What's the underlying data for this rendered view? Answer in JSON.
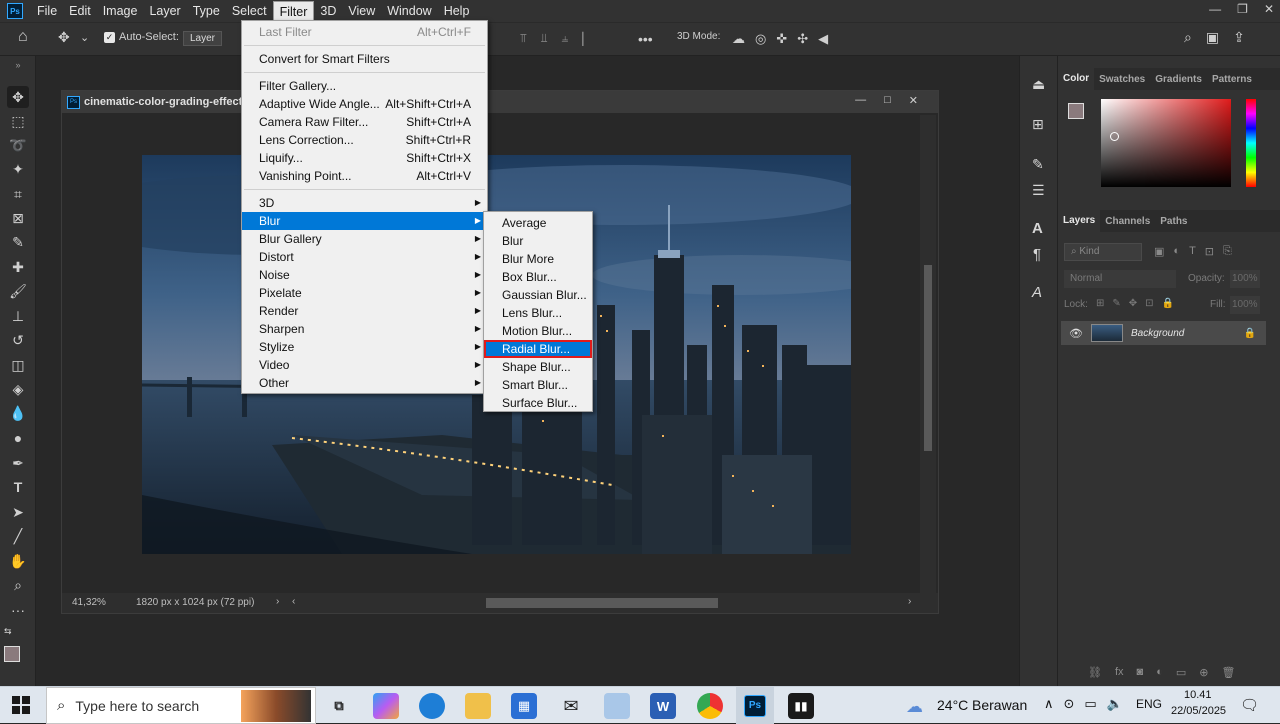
{
  "menubar": {
    "items": [
      "File",
      "Edit",
      "Image",
      "Layer",
      "Type",
      "Select",
      "Filter",
      "3D",
      "View",
      "Window",
      "Help"
    ],
    "active": "Filter"
  },
  "options": {
    "auto_select": "Auto-Select:",
    "layer_select": "Layer",
    "mode_3d": "3D Mode:"
  },
  "document": {
    "title": "cinematic-color-grading-effects-",
    "zoom": "41,32%",
    "dimensions": "1820 px x 1024 px (72 ppi)"
  },
  "filter_menu": {
    "group1": [
      {
        "label": "Last Filter",
        "shortcut": "Alt+Ctrl+F",
        "disabled": true
      }
    ],
    "group2": [
      {
        "label": "Convert for Smart Filters",
        "shortcut": ""
      }
    ],
    "group3": [
      {
        "label": "Filter Gallery...",
        "shortcut": ""
      },
      {
        "label": "Adaptive Wide Angle...",
        "shortcut": "Alt+Shift+Ctrl+A"
      },
      {
        "label": "Camera Raw Filter...",
        "shortcut": "Shift+Ctrl+A"
      },
      {
        "label": "Lens Correction...",
        "shortcut": "Shift+Ctrl+R"
      },
      {
        "label": "Liquify...",
        "shortcut": "Shift+Ctrl+X"
      },
      {
        "label": "Vanishing Point...",
        "shortcut": "Alt+Ctrl+V"
      }
    ],
    "group4": [
      "3D",
      "Blur",
      "Blur Gallery",
      "Distort",
      "Noise",
      "Pixelate",
      "Render",
      "Sharpen",
      "Stylize",
      "Video",
      "Other"
    ],
    "highlighted": "Blur"
  },
  "blur_submenu": {
    "items": [
      "Average",
      "Blur",
      "Blur More",
      "Box Blur...",
      "Gaussian Blur...",
      "Lens Blur...",
      "Motion Blur...",
      "Radial Blur...",
      "Shape Blur...",
      "Smart Blur...",
      "Surface Blur..."
    ],
    "highlighted": "Radial Blur..."
  },
  "color_panel": {
    "tabs": [
      "Color",
      "Swatches",
      "Gradients",
      "Patterns"
    ],
    "active": "Color",
    "hue_color": "#e01b1b"
  },
  "layers_panel": {
    "tabs": [
      "Layers",
      "Channels",
      "Paths"
    ],
    "active": "Layers",
    "kind_label": "Kind",
    "blend_mode": "Normal",
    "opacity_label": "Opacity:",
    "opacity_value": "100%",
    "lock_label": "Lock:",
    "fill_label": "Fill:",
    "fill_value": "100%",
    "layer_name": "Background"
  },
  "taskbar": {
    "search_placeholder": "Type here to search",
    "weather_temp": "24°C",
    "weather_desc": "Berawan",
    "language": "ENG",
    "time": "10.41",
    "date": "22/05/2025"
  }
}
